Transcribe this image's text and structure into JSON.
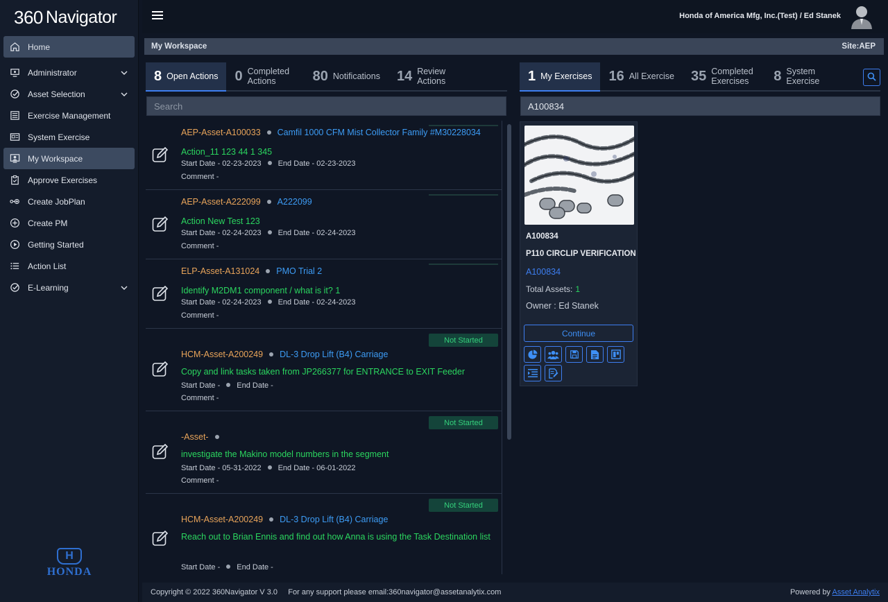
{
  "app": {
    "logo_num": "360",
    "logo_word": "Navigator"
  },
  "sidebar": {
    "items": [
      {
        "label": "Home",
        "icon": "home-icon"
      },
      {
        "label": "Administrator",
        "icon": "admin-icon"
      },
      {
        "label": "Asset Selection",
        "icon": "check-circle-icon"
      },
      {
        "label": "Exercise Management",
        "icon": "list-icon"
      },
      {
        "label": "System Exercise",
        "icon": "id-card-icon"
      },
      {
        "label": "My Workspace",
        "icon": "workspace-icon"
      },
      {
        "label": "Approve Exercises",
        "icon": "clipboard-icon"
      },
      {
        "label": "Create JobPlan",
        "icon": "link-icon"
      },
      {
        "label": "Create PM",
        "icon": "plus-circle-icon"
      },
      {
        "label": "Getting Started",
        "icon": "play-circle-icon"
      },
      {
        "label": "Action List",
        "icon": "bullet-list-icon"
      },
      {
        "label": "E-Learning",
        "icon": "check-circle-icon"
      }
    ],
    "brand": "HONDA",
    "brand_mark": "H"
  },
  "topbar": {
    "user": "Honda of America Mfg, Inc.(Test) / Ed Stanek"
  },
  "titlebar": {
    "title": "My Workspace",
    "site": "Site:AEP"
  },
  "left_tabs": [
    {
      "count": "8",
      "label": "Open Actions"
    },
    {
      "count": "0",
      "label": "Completed Actions"
    },
    {
      "count": "80",
      "label": "Notifications"
    },
    {
      "count": "14",
      "label": "Review Actions"
    }
  ],
  "right_tabs": [
    {
      "count": "1",
      "label": "My Exercises"
    },
    {
      "count": "16",
      "label": "All Exercise"
    },
    {
      "count": "35",
      "label": "Completed Exercises"
    },
    {
      "count": "8",
      "label": "System Exercise"
    }
  ],
  "left_search": {
    "placeholder": "Search",
    "value": ""
  },
  "right_search": {
    "value": "A100834"
  },
  "actions": [
    {
      "asset": "AEP-Asset-A100033",
      "link": "Camfil 1000 CFM Mist Collector Family #M30228034",
      "action": "Action_11 123 44 1 345",
      "start": "Start Date - 02-23-2023",
      "end": "End Date - 02-23-2023",
      "comment": "Comment -",
      "status": ""
    },
    {
      "asset": "AEP-Asset-A222099",
      "link": "A222099",
      "action": "Action New Test 123",
      "start": "Start Date - 02-24-2023",
      "end": "End Date - 02-24-2023",
      "comment": "Comment -",
      "status": ""
    },
    {
      "asset": "ELP-Asset-A131024",
      "link": "PMO Trial 2",
      "action": "Identify M2DM1 component / what is it? 1",
      "start": "Start Date - 02-24-2023",
      "end": "End Date - 02-24-2023",
      "comment": "Comment -",
      "status": ""
    },
    {
      "asset": "HCM-Asset-A200249",
      "link": "DL-3 Drop Lift (B4) Carriage",
      "action": "Copy and link tasks taken from JP266377 for ENTRANCE to EXIT Feeder",
      "start": "Start Date -",
      "end": "End Date -",
      "comment": "Comment -",
      "status": "Not Started"
    },
    {
      "asset": "-Asset-",
      "link": "",
      "action": "investigate the Makino model numbers in the segment",
      "start": "Start Date - 05-31-2022",
      "end": "End Date - 06-01-2022",
      "comment": "Comment -",
      "status": "Not Started"
    },
    {
      "asset": "HCM-Asset-A200249",
      "link": "DL-3 Drop Lift (B4) Carriage",
      "action": "Reach out to Brian Ennis and find out how Anna is using the Task Destination list",
      "start": "Start Date -",
      "end": "End Date -",
      "comment": "",
      "status": "Not Started"
    }
  ],
  "exercise": {
    "id": "A100834",
    "title": "P110 CIRCLIP VERIFICATION",
    "link": "A100834",
    "total_label": "Total Assets:",
    "total_value": "1",
    "owner": "Owner : Ed Stanek",
    "continue": "Continue",
    "icons": [
      "pie-chart-icon",
      "users-icon",
      "save-icon",
      "document-icon",
      "board-icon",
      "indent-icon",
      "edit-doc-icon"
    ]
  },
  "footer": {
    "copyright": "Copyright © 2022 360Navigator V 3.0     For any support please email:360navigator@assetanalytix.com",
    "powered": "Powered by",
    "powered_link": "Asset Analytix"
  },
  "colors": {
    "accent": "#3e7ef0",
    "green": "#2bd65f",
    "orange": "#e8a45a",
    "link": "#3d9cf5"
  }
}
